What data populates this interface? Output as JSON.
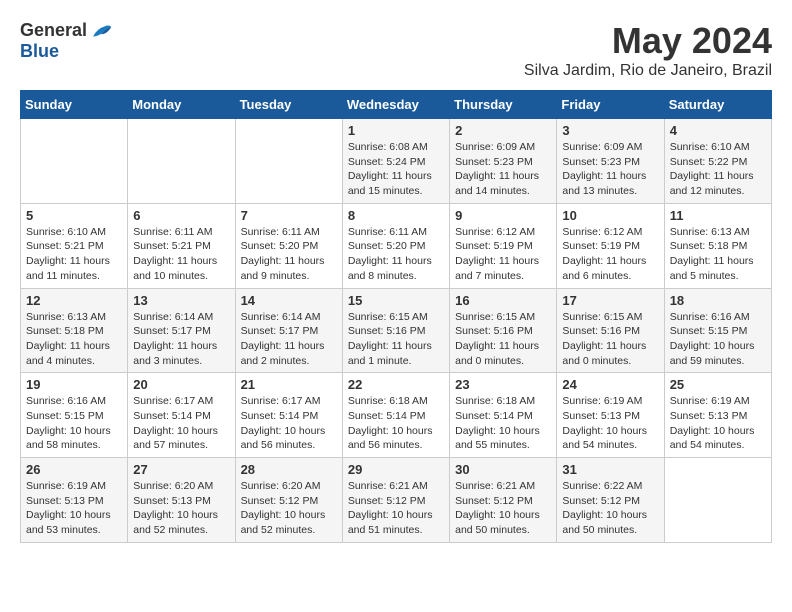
{
  "logo": {
    "general": "General",
    "blue": "Blue"
  },
  "title": "May 2024",
  "location": "Silva Jardim, Rio de Janeiro, Brazil",
  "days_of_week": [
    "Sunday",
    "Monday",
    "Tuesday",
    "Wednesday",
    "Thursday",
    "Friday",
    "Saturday"
  ],
  "weeks": [
    [
      {
        "num": "",
        "info": ""
      },
      {
        "num": "",
        "info": ""
      },
      {
        "num": "",
        "info": ""
      },
      {
        "num": "1",
        "info": "Sunrise: 6:08 AM\nSunset: 5:24 PM\nDaylight: 11 hours and 15 minutes."
      },
      {
        "num": "2",
        "info": "Sunrise: 6:09 AM\nSunset: 5:23 PM\nDaylight: 11 hours and 14 minutes."
      },
      {
        "num": "3",
        "info": "Sunrise: 6:09 AM\nSunset: 5:23 PM\nDaylight: 11 hours and 13 minutes."
      },
      {
        "num": "4",
        "info": "Sunrise: 6:10 AM\nSunset: 5:22 PM\nDaylight: 11 hours and 12 minutes."
      }
    ],
    [
      {
        "num": "5",
        "info": "Sunrise: 6:10 AM\nSunset: 5:21 PM\nDaylight: 11 hours and 11 minutes."
      },
      {
        "num": "6",
        "info": "Sunrise: 6:11 AM\nSunset: 5:21 PM\nDaylight: 11 hours and 10 minutes."
      },
      {
        "num": "7",
        "info": "Sunrise: 6:11 AM\nSunset: 5:20 PM\nDaylight: 11 hours and 9 minutes."
      },
      {
        "num": "8",
        "info": "Sunrise: 6:11 AM\nSunset: 5:20 PM\nDaylight: 11 hours and 8 minutes."
      },
      {
        "num": "9",
        "info": "Sunrise: 6:12 AM\nSunset: 5:19 PM\nDaylight: 11 hours and 7 minutes."
      },
      {
        "num": "10",
        "info": "Sunrise: 6:12 AM\nSunset: 5:19 PM\nDaylight: 11 hours and 6 minutes."
      },
      {
        "num": "11",
        "info": "Sunrise: 6:13 AM\nSunset: 5:18 PM\nDaylight: 11 hours and 5 minutes."
      }
    ],
    [
      {
        "num": "12",
        "info": "Sunrise: 6:13 AM\nSunset: 5:18 PM\nDaylight: 11 hours and 4 minutes."
      },
      {
        "num": "13",
        "info": "Sunrise: 6:14 AM\nSunset: 5:17 PM\nDaylight: 11 hours and 3 minutes."
      },
      {
        "num": "14",
        "info": "Sunrise: 6:14 AM\nSunset: 5:17 PM\nDaylight: 11 hours and 2 minutes."
      },
      {
        "num": "15",
        "info": "Sunrise: 6:15 AM\nSunset: 5:16 PM\nDaylight: 11 hours and 1 minute."
      },
      {
        "num": "16",
        "info": "Sunrise: 6:15 AM\nSunset: 5:16 PM\nDaylight: 11 hours and 0 minutes."
      },
      {
        "num": "17",
        "info": "Sunrise: 6:15 AM\nSunset: 5:16 PM\nDaylight: 11 hours and 0 minutes."
      },
      {
        "num": "18",
        "info": "Sunrise: 6:16 AM\nSunset: 5:15 PM\nDaylight: 10 hours and 59 minutes."
      }
    ],
    [
      {
        "num": "19",
        "info": "Sunrise: 6:16 AM\nSunset: 5:15 PM\nDaylight: 10 hours and 58 minutes."
      },
      {
        "num": "20",
        "info": "Sunrise: 6:17 AM\nSunset: 5:14 PM\nDaylight: 10 hours and 57 minutes."
      },
      {
        "num": "21",
        "info": "Sunrise: 6:17 AM\nSunset: 5:14 PM\nDaylight: 10 hours and 56 minutes."
      },
      {
        "num": "22",
        "info": "Sunrise: 6:18 AM\nSunset: 5:14 PM\nDaylight: 10 hours and 56 minutes."
      },
      {
        "num": "23",
        "info": "Sunrise: 6:18 AM\nSunset: 5:14 PM\nDaylight: 10 hours and 55 minutes."
      },
      {
        "num": "24",
        "info": "Sunrise: 6:19 AM\nSunset: 5:13 PM\nDaylight: 10 hours and 54 minutes."
      },
      {
        "num": "25",
        "info": "Sunrise: 6:19 AM\nSunset: 5:13 PM\nDaylight: 10 hours and 54 minutes."
      }
    ],
    [
      {
        "num": "26",
        "info": "Sunrise: 6:19 AM\nSunset: 5:13 PM\nDaylight: 10 hours and 53 minutes."
      },
      {
        "num": "27",
        "info": "Sunrise: 6:20 AM\nSunset: 5:13 PM\nDaylight: 10 hours and 52 minutes."
      },
      {
        "num": "28",
        "info": "Sunrise: 6:20 AM\nSunset: 5:12 PM\nDaylight: 10 hours and 52 minutes."
      },
      {
        "num": "29",
        "info": "Sunrise: 6:21 AM\nSunset: 5:12 PM\nDaylight: 10 hours and 51 minutes."
      },
      {
        "num": "30",
        "info": "Sunrise: 6:21 AM\nSunset: 5:12 PM\nDaylight: 10 hours and 50 minutes."
      },
      {
        "num": "31",
        "info": "Sunrise: 6:22 AM\nSunset: 5:12 PM\nDaylight: 10 hours and 50 minutes."
      },
      {
        "num": "",
        "info": ""
      }
    ]
  ]
}
